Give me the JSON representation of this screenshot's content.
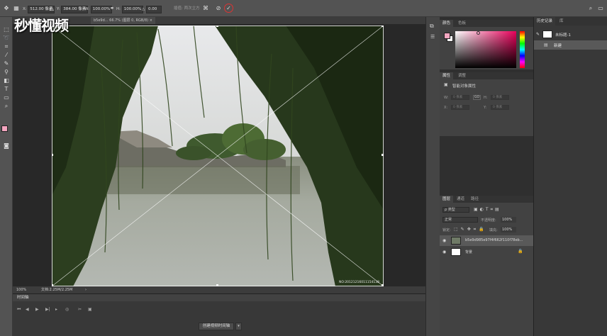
{
  "options_bar": {
    "x_label": "X:",
    "x_value": "512.00 像素",
    "y_label": "Y:",
    "y_value": "384.00 像素",
    "w_label": "W:",
    "w_value": "100.00%",
    "h_label": "H:",
    "h_value": "100.00%",
    "angle_label": "△",
    "angle_value": "0.00",
    "interp_label": "插值:",
    "interp_value": "两次立方",
    "icons": [
      "move-icon",
      "reference-point-icon",
      "link-icon",
      "angle-icon",
      "warp-icon",
      "cancel-icon",
      "commit-icon"
    ]
  },
  "watermark": {
    "text": "秒懂视频"
  },
  "document": {
    "tab_title": "b5e9d... 66.7% (图层 0, RGB/8)",
    "tab_close": "×",
    "status_zoom": "100%",
    "status_doc": "文档:2.25M/2.25M",
    "status_arrow": "›",
    "photo_caption": "NO:20121216011154138"
  },
  "timeline": {
    "tab_label": "时间轴",
    "create_button": "创建视频时间轴",
    "create_arrow": "▾",
    "controls": [
      "⏮",
      "◀",
      "▶",
      "▶|",
      "▸",
      "◎",
      "✂",
      "▣"
    ]
  },
  "color_panel": {
    "tabs": [
      "颜色",
      "色板"
    ],
    "fg_color": "#f4a6c0",
    "bg_color": "#ffffff",
    "hue_color": "#e8005a"
  },
  "properties_panel": {
    "tabs": [
      "属性",
      "调整"
    ],
    "title": "智能对象属性",
    "w_label": "W:",
    "w_placeholder": "0 像素",
    "h_label": "H:",
    "h_placeholder": "0 像素",
    "x_label": "X:",
    "x_placeholder": "0 像素",
    "y_label": "Y:",
    "y_placeholder": "0 像素",
    "link_label": "GO"
  },
  "layers_panel": {
    "tabs": [
      "图层",
      "通道",
      "路径"
    ],
    "filter_label": "ρ 类型",
    "blend_mode": "正常",
    "opacity_label": "不透明度:",
    "opacity_value": "100%",
    "lock_label": "锁定:",
    "fill_label": "填充:",
    "fill_value": "100%",
    "layers": [
      {
        "name": "b5e9d985e97f4f662f110f78eb...",
        "thumb_color": "#6f7a66",
        "selected": true
      },
      {
        "name": "背景",
        "thumb_color": "#ffffff",
        "selected": false,
        "locked": true
      }
    ]
  },
  "history_panel": {
    "tabs": [
      "历史记录",
      "库"
    ],
    "items": [
      {
        "label": "未标题-1",
        "type": "snapshot"
      },
      {
        "label": "新建",
        "type": "step"
      }
    ]
  }
}
